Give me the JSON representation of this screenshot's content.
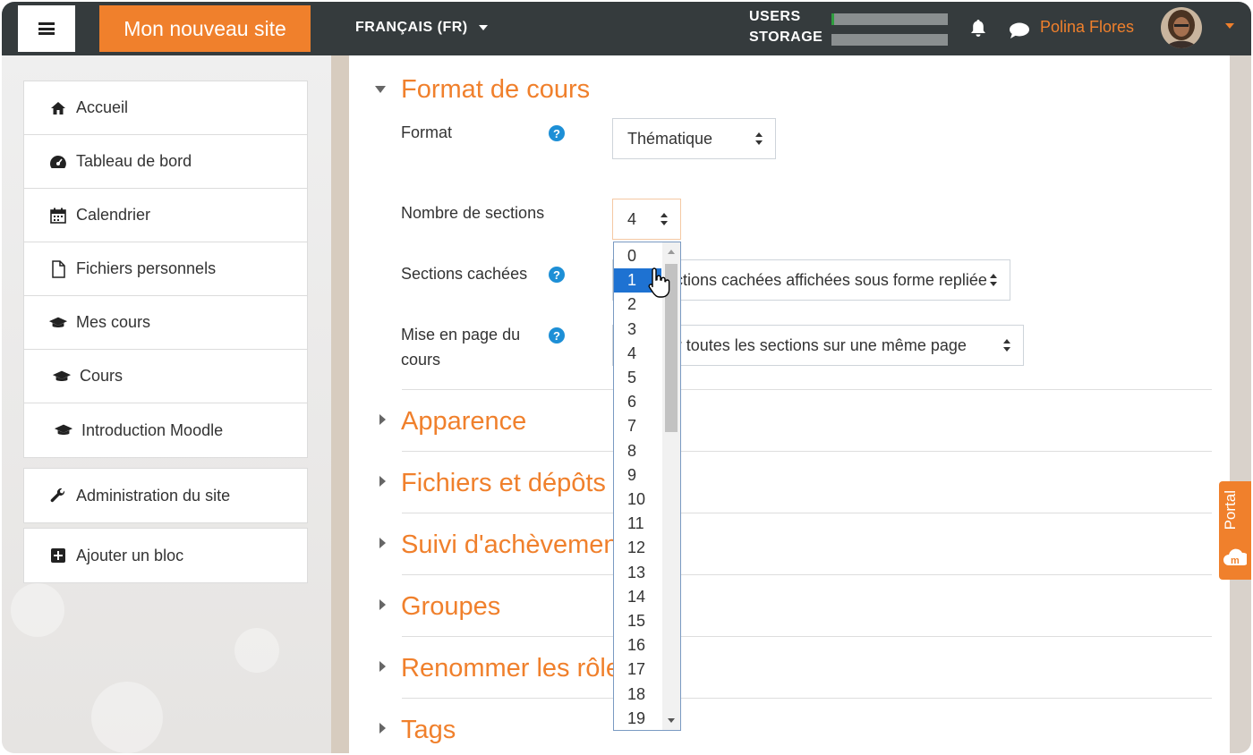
{
  "navbar": {
    "site_name": "Mon nouveau site",
    "language": "FRANÇAIS (FR)",
    "quota_users_label": "USERS",
    "quota_storage_label": "STORAGE",
    "quota_users_fraction": 0.02,
    "quota_storage_fraction": 0.0,
    "user_name": "Polina Flores",
    "accent_color": "#f0802c",
    "bar_color": "#353b3d"
  },
  "sidebar": {
    "items": [
      {
        "label": "Accueil",
        "icon": "home-icon"
      },
      {
        "label": "Tableau de bord",
        "icon": "dashboard-icon"
      },
      {
        "label": "Calendrier",
        "icon": "calendar-icon"
      },
      {
        "label": "Fichiers personnels",
        "icon": "file-icon"
      },
      {
        "label": "Mes cours",
        "icon": "graduation-cap-icon"
      },
      {
        "label": "Cours",
        "icon": "graduation-cap-icon"
      },
      {
        "label": "Introduction Moodle",
        "icon": "graduation-cap-icon"
      }
    ],
    "admin": {
      "label": "Administration du site",
      "icon": "wrench-icon"
    },
    "add_block": {
      "label": "Ajouter un bloc",
      "icon": "plus-square-icon"
    }
  },
  "main": {
    "format_section": {
      "title": "Format de cours",
      "format_label": "Format",
      "format_value": "Thématique",
      "sections_label": "Nombre de sections",
      "sections_value": "4",
      "hidden_label": "Sections cachées",
      "hidden_value": "Les sections cachées affichées sous forme repliée",
      "layout_label_line1": "Mise en page du",
      "layout_label_line2": "cours",
      "layout_value": "Afficher toutes les sections sur une même page"
    },
    "collapsed_sections": [
      "Apparence",
      "Fichiers et dépôts",
      "Suivi d'achèvement",
      "Groupes",
      "Renommer les rôles",
      "Tags"
    ]
  },
  "dropdown": {
    "options": [
      "0",
      "1",
      "2",
      "3",
      "4",
      "5",
      "6",
      "7",
      "8",
      "9",
      "10",
      "11",
      "12",
      "13",
      "14",
      "15",
      "16",
      "17",
      "18",
      "19"
    ],
    "highlighted": "1"
  },
  "portal": {
    "label": "Portal"
  }
}
